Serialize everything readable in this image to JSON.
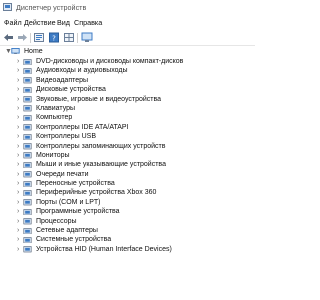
{
  "window": {
    "title": "Диспетчер устройств"
  },
  "menu": {
    "items": [
      "Файл",
      "Действие",
      "Вид",
      "Справка"
    ]
  },
  "toolbar": {
    "buttons": [
      "back-arrow-icon",
      "forward-arrow-icon",
      "properties-icon",
      "help-icon",
      "grid-icon",
      "monitor-scan-icon"
    ]
  },
  "tree": {
    "root": {
      "label": "Home",
      "expanded": true
    },
    "items": [
      {
        "label": "DVD-дисководы и дисководы компакт-дисков",
        "icon": "dvd-drive-icon"
      },
      {
        "label": "Аудиовходы и аудиовыходы",
        "icon": "audio-io-icon"
      },
      {
        "label": "Видеоадаптеры",
        "icon": "display-adapter-icon"
      },
      {
        "label": "Дисковые устройства",
        "icon": "disk-drive-icon"
      },
      {
        "label": "Звуковые, игровые и видеоустройства",
        "icon": "sound-device-icon"
      },
      {
        "label": "Клавиатуры",
        "icon": "keyboard-icon"
      },
      {
        "label": "Компьютер",
        "icon": "computer-icon"
      },
      {
        "label": "Контроллеры IDE ATA/ATAPI",
        "icon": "ide-controller-icon"
      },
      {
        "label": "Контроллеры USB",
        "icon": "usb-controller-icon"
      },
      {
        "label": "Контроллеры запоминающих устройств",
        "icon": "storage-controller-icon"
      },
      {
        "label": "Мониторы",
        "icon": "monitor-icon"
      },
      {
        "label": "Мыши и иные указывающие устройства",
        "icon": "mouse-icon"
      },
      {
        "label": "Очереди печати",
        "icon": "print-queue-icon"
      },
      {
        "label": "Переносные устройства",
        "icon": "portable-device-icon"
      },
      {
        "label": "Периферийные устройства Xbox 360",
        "icon": "xbox-peripheral-icon"
      },
      {
        "label": "Порты (COM и LPT)",
        "icon": "port-icon"
      },
      {
        "label": "Программные устройства",
        "icon": "software-device-icon"
      },
      {
        "label": "Процессоры",
        "icon": "processor-icon"
      },
      {
        "label": "Сетевые адаптеры",
        "icon": "network-adapter-icon"
      },
      {
        "label": "Системные устройства",
        "icon": "system-device-icon"
      },
      {
        "label": "Устройства HID (Human Interface Devices)",
        "icon": "hid-device-icon"
      }
    ]
  },
  "colors": {
    "icon_blue": "#3d7bc4",
    "icon_dark": "#4a5a6e",
    "icon_light": "#cfdcec"
  }
}
